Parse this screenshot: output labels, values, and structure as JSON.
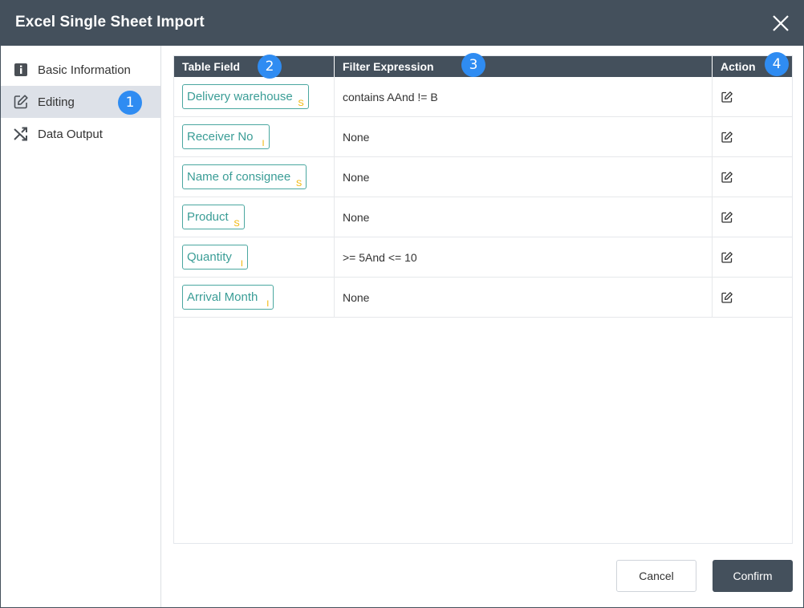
{
  "dialog": {
    "title": "Excel Single Sheet Import"
  },
  "sidebar": {
    "items": [
      {
        "label": "Basic Information",
        "icon": "info-icon"
      },
      {
        "label": "Editing",
        "icon": "edit-icon",
        "active": true
      },
      {
        "label": "Data Output",
        "icon": "shuffle-icon"
      }
    ]
  },
  "table": {
    "headers": [
      "Table Field",
      "Filter Expression",
      "Action"
    ],
    "rows": [
      {
        "field": "Delivery warehouse",
        "type": "S",
        "filter": "contains AAnd != B"
      },
      {
        "field": "Receiver No",
        "type": "I",
        "filter": "None"
      },
      {
        "field": "Name of consignee",
        "type": "S",
        "filter": "None"
      },
      {
        "field": "Product",
        "type": "S",
        "filter": "None"
      },
      {
        "field": "Quantity",
        "type": "I",
        "filter": ">= 5And <= 10"
      },
      {
        "field": "Arrival Month",
        "type": "I",
        "filter": "None"
      }
    ]
  },
  "badges": [
    "1",
    "2",
    "3",
    "4"
  ],
  "footer": {
    "cancel_label": "Cancel",
    "confirm_label": "Confirm"
  },
  "colors": {
    "header_bg": "#44505c",
    "badge": "#2f8cf2",
    "tag_border": "#4aa7a0",
    "type_letter": "#f0b400",
    "active_item_bg": "#dde1e8"
  }
}
